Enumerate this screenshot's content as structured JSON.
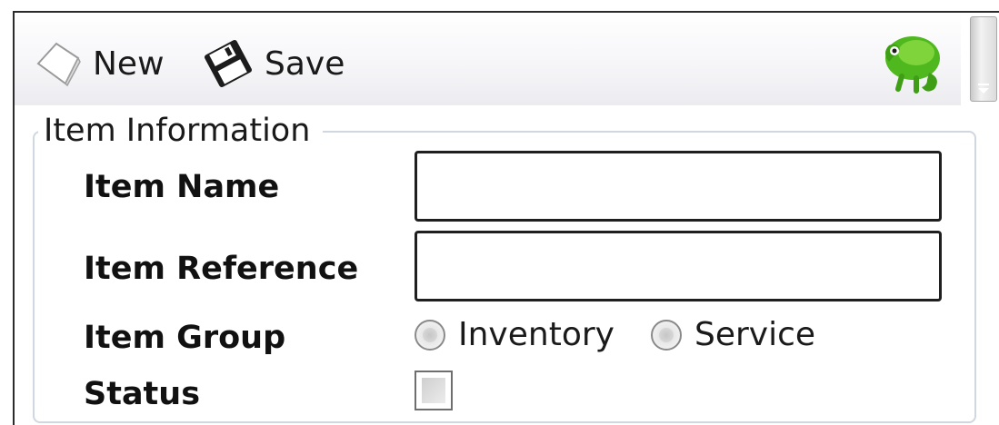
{
  "toolbar": {
    "new_label": "New",
    "save_label": "Save",
    "icons": {
      "new": "new-document-icon",
      "save": "floppy-disk-icon",
      "logo": "chameleon-logo-icon",
      "scroll": "scroll-down-arrow-icon"
    }
  },
  "form": {
    "group_title": "Item Information",
    "fields": {
      "item_name": {
        "label": "Item Name",
        "value": ""
      },
      "item_reference": {
        "label": "Item Reference",
        "value": ""
      },
      "item_group": {
        "label": "Item Group",
        "options": [
          "Inventory",
          "Service"
        ],
        "selected": null
      },
      "status": {
        "label": "Status",
        "checked": false
      }
    }
  },
  "colors": {
    "logo_green": "#4fb81e",
    "border_dark": "#1f1f1f",
    "group_border": "#d0d7e0"
  }
}
